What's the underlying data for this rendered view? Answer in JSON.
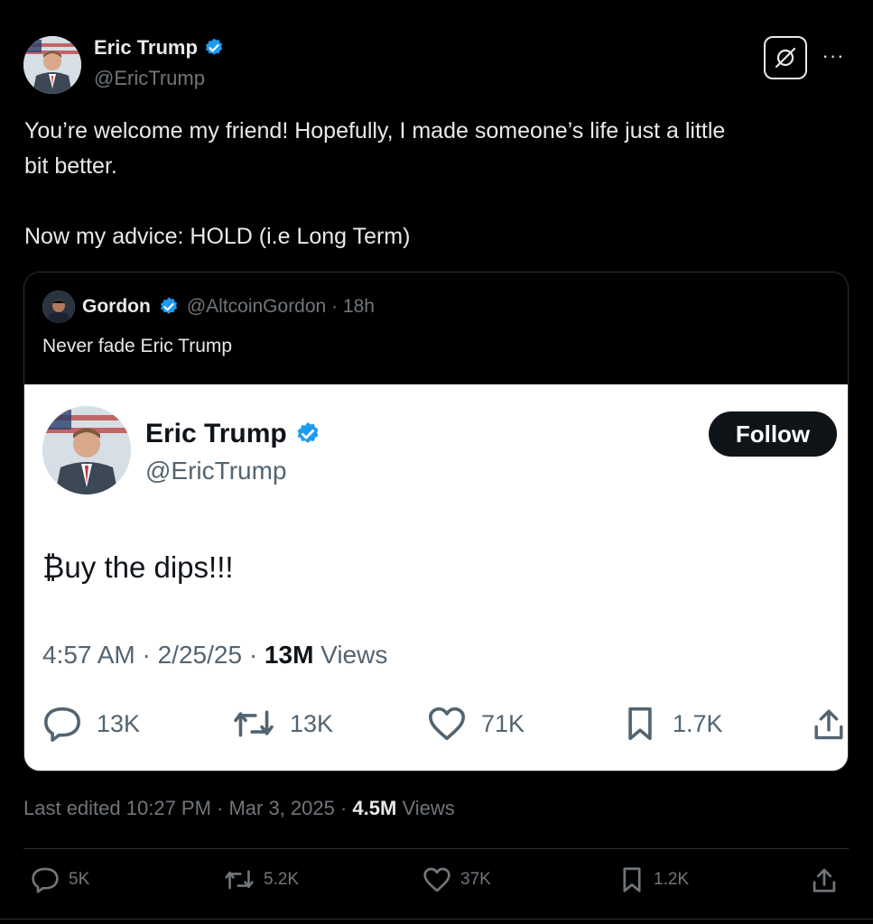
{
  "tweet": {
    "author_name": "Eric Trump",
    "author_handle": "@EricTrump",
    "text_line1": "You’re welcome my friend! Hopefully, I made someone’s life just a little",
    "text_line2": "bit better.",
    "text_line3": "Now my advice: HOLD (i.e Long Term)"
  },
  "quote": {
    "author_name": "Gordon",
    "author_handle_time": "@AltcoinGordon · 18h",
    "text": "Never fade Eric Trump",
    "embed": {
      "author_name": "Eric Trump",
      "author_handle": "@EricTrump",
      "follow_label": "Follow",
      "text": "₿uy the dips!!!",
      "time_date": "4:57 AM · 2/25/25 · ",
      "views_count": "13M",
      "views_label": " Views",
      "replies": "13K",
      "reposts": "13K",
      "likes": "71K",
      "bookmarks": "1.7K"
    }
  },
  "footer": {
    "last_edited": "Last edited 10:27 PM · Mar 3, 2025 · ",
    "views_count": "4.5M",
    "views_label": " Views",
    "replies": "5K",
    "reposts": "5.2K",
    "likes": "37K",
    "bookmarks": "1.2K"
  },
  "icons": {
    "verified": "verified-badge-icon",
    "reply": "reply-icon",
    "repost": "repost-icon",
    "like": "heart-icon",
    "bookmark": "bookmark-icon",
    "share": "share-icon",
    "grok": "grok-icon",
    "more": "more-icon"
  },
  "colors": {
    "background": "#000000",
    "verified": "#1d9bf0",
    "muted": "#71767b",
    "text": "#e7e9ea"
  }
}
